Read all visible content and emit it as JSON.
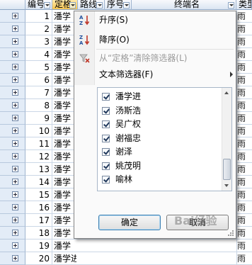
{
  "columns": [
    {
      "label": "编号",
      "filter": true
    },
    {
      "label": "定格",
      "filter": true,
      "active": true
    },
    {
      "label": "路线",
      "filter": true
    },
    {
      "label": "序号",
      "filter": true
    },
    {
      "label": "终端名",
      "filter": true
    },
    {
      "label": "类型",
      "filter": true
    }
  ],
  "rows": [
    {
      "id": "1",
      "name": "潘学",
      "extra": "雨"
    },
    {
      "id": "2",
      "name": "潘学",
      "extra": "雨"
    },
    {
      "id": "3",
      "name": "潘学",
      "extra": "雨"
    },
    {
      "id": "4",
      "name": "潘学",
      "extra": "雨"
    },
    {
      "id": "5",
      "name": "潘学",
      "extra": "雨"
    },
    {
      "id": "6",
      "name": "潘学",
      "extra": "雨"
    },
    {
      "id": "7",
      "name": "潘学",
      "extra": "雨"
    },
    {
      "id": "8",
      "name": "潘学",
      "extra": "雨"
    },
    {
      "id": "9",
      "name": "潘学",
      "extra": "雨"
    },
    {
      "id": "10",
      "name": "潘学",
      "extra": "雨"
    },
    {
      "id": "11",
      "name": "潘学",
      "extra": "雨"
    },
    {
      "id": "12",
      "name": "潘学",
      "extra": "雨"
    },
    {
      "id": "13",
      "name": "潘学",
      "extra": "雨"
    },
    {
      "id": "14",
      "name": "潘学",
      "extra": "雨"
    },
    {
      "id": "15",
      "name": "潘学",
      "extra": "雨"
    },
    {
      "id": "16",
      "name": "潘学",
      "extra": "雨"
    },
    {
      "id": "17",
      "name": "潘学",
      "extra": "雨"
    },
    {
      "id": "18",
      "name": "潘学",
      "extra": "雨"
    },
    {
      "id": "19",
      "name": "潘学",
      "extra": "雨"
    },
    {
      "id": "20",
      "name": "潘学进",
      "extra": "雨"
    }
  ],
  "menu": {
    "sort_asc": "升序(S)",
    "sort_desc": "降序(O)",
    "clear_filter": "从“定格”清除筛选器(L)",
    "text_filter": "文本筛选器(F)",
    "items": [
      {
        "label": "潘学进",
        "checked": true
      },
      {
        "label": "汤斯浩",
        "checked": true
      },
      {
        "label": "吴广权",
        "checked": true
      },
      {
        "label": "谢福忠",
        "checked": true
      },
      {
        "label": "谢泽",
        "checked": true
      },
      {
        "label": "姚茂明",
        "checked": true
      },
      {
        "label": "喻林",
        "checked": true
      }
    ],
    "ok": "确定",
    "cancel": "取消"
  },
  "watermark": "Bai经验"
}
